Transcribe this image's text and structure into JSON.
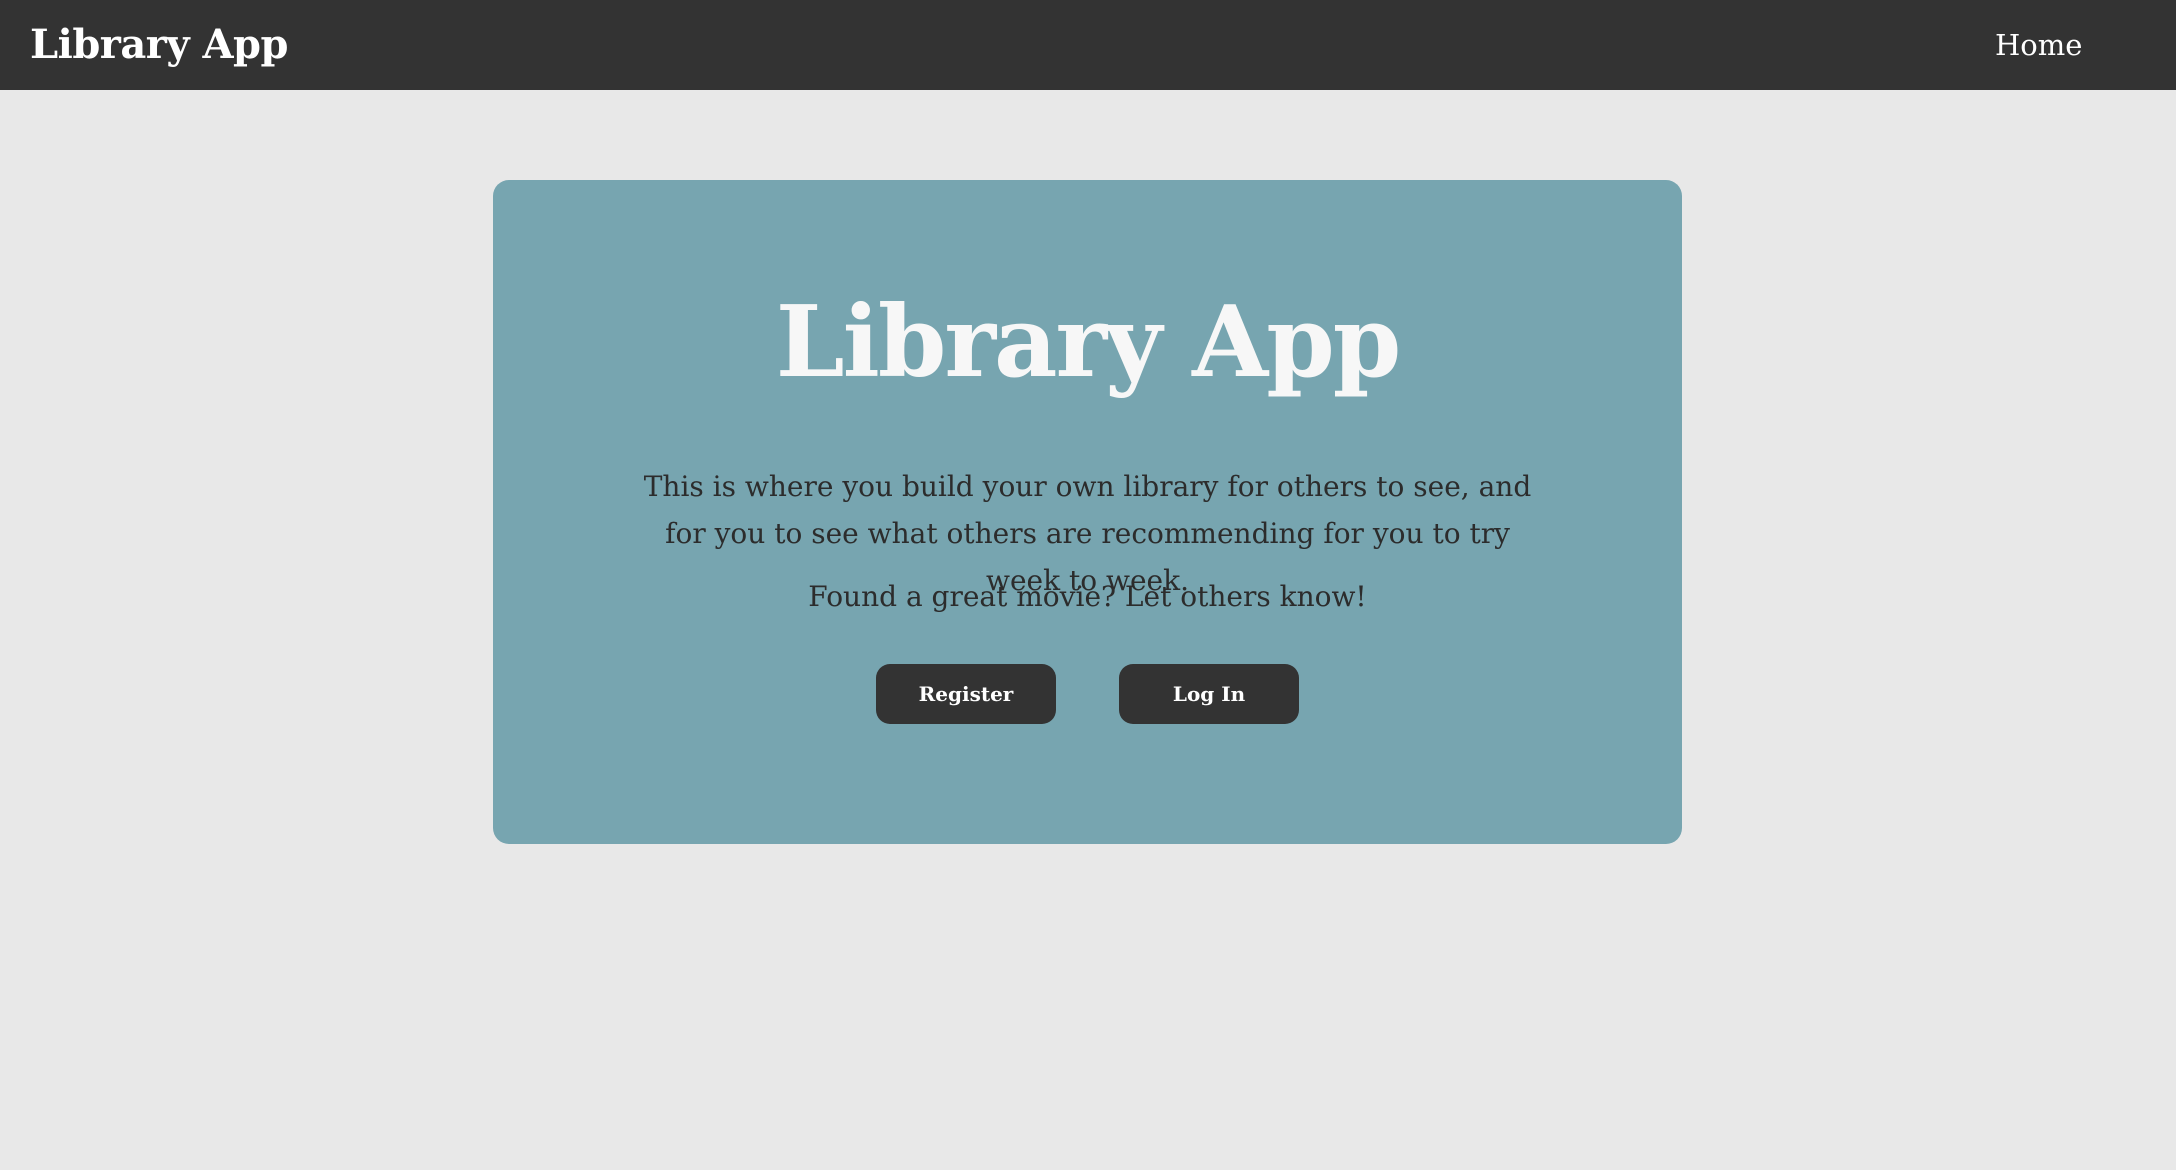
{
  "navbar": {
    "brand": "Library App",
    "links": [
      {
        "label": "Home"
      }
    ]
  },
  "hero": {
    "title": "Library App",
    "description": "This is where you build your own library for others to see, and for you to see what others are recommending for you to try week to week.",
    "call_to_action": "Found a great movie? Let others know!",
    "buttons": {
      "register": "Register",
      "login": "Log In"
    }
  },
  "colors": {
    "navbar_background": "#333333",
    "page_background": "#e8e8e8",
    "hero_background": "#77a5b0",
    "button_background": "#333333",
    "text_light": "#ffffff",
    "text_dark": "#2c2c2c"
  }
}
